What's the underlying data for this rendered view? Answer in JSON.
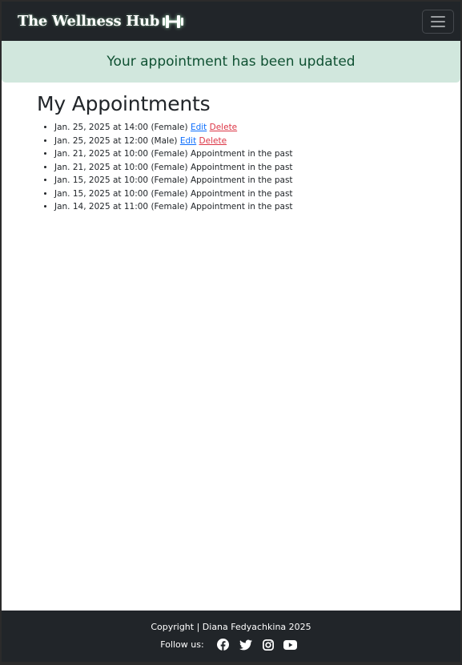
{
  "navbar": {
    "brand": "The Wellness Hub",
    "brand_icon": "dumbbell-icon",
    "toggler_icon": "hamburger-menu-icon"
  },
  "alert": {
    "message": "Your appointment has been updated"
  },
  "main": {
    "title": "My Appointments",
    "appointments": [
      {
        "text": "Jan. 25, 2025 at 14:00 (Female)",
        "edit": "Edit",
        "delete": "Delete"
      },
      {
        "text": "Jan. 25, 2025 at 12:00 (Male)",
        "edit": "Edit",
        "delete": "Delete"
      },
      {
        "text": "Jan. 21, 2025 at 10:00 (Female)",
        "status": "Appointment in the past"
      },
      {
        "text": "Jan. 21, 2025 at 10:00 (Female)",
        "status": "Appointment in the past"
      },
      {
        "text": "Jan. 15, 2025 at 10:00 (Female)",
        "status": "Appointment in the past"
      },
      {
        "text": "Jan. 15, 2025 at 10:00 (Female)",
        "status": "Appointment in the past"
      },
      {
        "text": "Jan. 14, 2025 at 11:00 (Female)",
        "status": "Appointment in the past"
      }
    ]
  },
  "footer": {
    "copyright": "Copyright | Diana Fedyachkina 2025",
    "follow_label": "Follow us:",
    "social_icons": [
      "facebook-icon",
      "twitter-icon",
      "instagram-icon",
      "youtube-icon"
    ]
  },
  "colors": {
    "navbar_bg": "#212529",
    "alert_bg": "#d1e7dd",
    "alert_text": "#0f5132",
    "link_edit": "#0d6efd",
    "link_delete": "#dc3545"
  }
}
